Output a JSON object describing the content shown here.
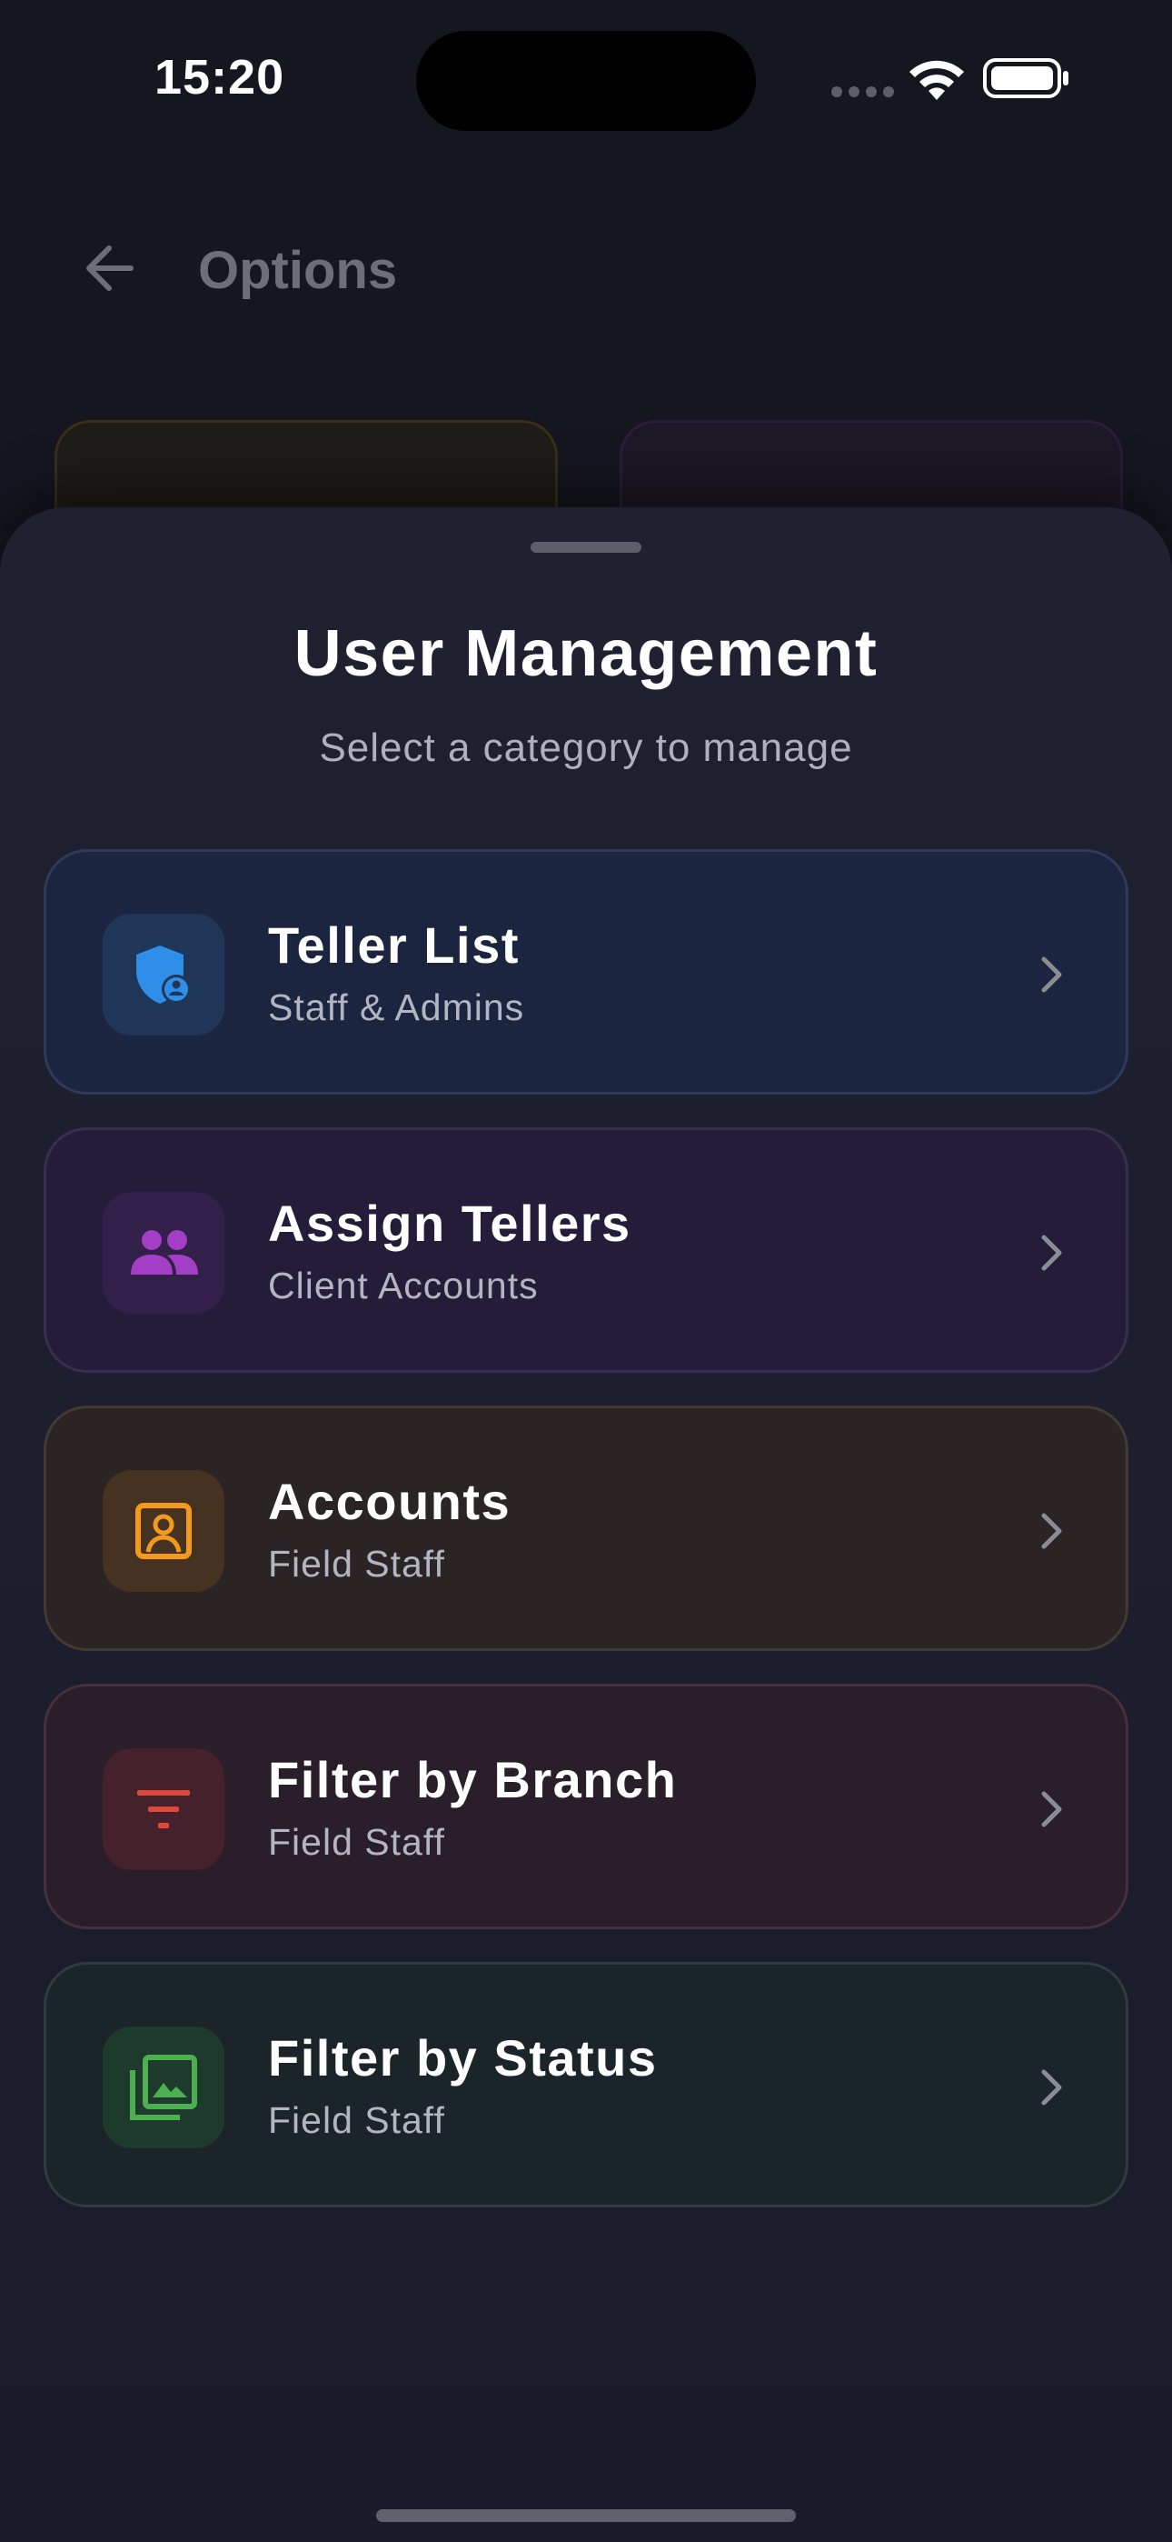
{
  "status_bar": {
    "time": "15:20",
    "icons": [
      "signal-icon",
      "wifi-icon",
      "battery-icon"
    ]
  },
  "app_bar": {
    "title": "Options",
    "back_icon": "arrow-left-icon"
  },
  "sheet": {
    "title": "User Management",
    "subtitle": "Select a category to manage",
    "options": [
      {
        "title": "Teller List",
        "subtitle": "Staff & Admins",
        "icon": "shield-user-icon",
        "color": "#2f8ee8"
      },
      {
        "title": "Assign Tellers",
        "subtitle": "Client Accounts",
        "icon": "group-icon",
        "color": "#a33fc4"
      },
      {
        "title": "Accounts",
        "subtitle": "Field Staff",
        "icon": "account-box-icon",
        "color": "#f39a1c"
      },
      {
        "title": "Filter by Branch",
        "subtitle": "Field Staff",
        "icon": "filter-icon",
        "color": "#e0463a"
      },
      {
        "title": "Filter by Status",
        "subtitle": "Field Staff",
        "icon": "photo-library-icon",
        "color": "#4cb050"
      }
    ]
  }
}
